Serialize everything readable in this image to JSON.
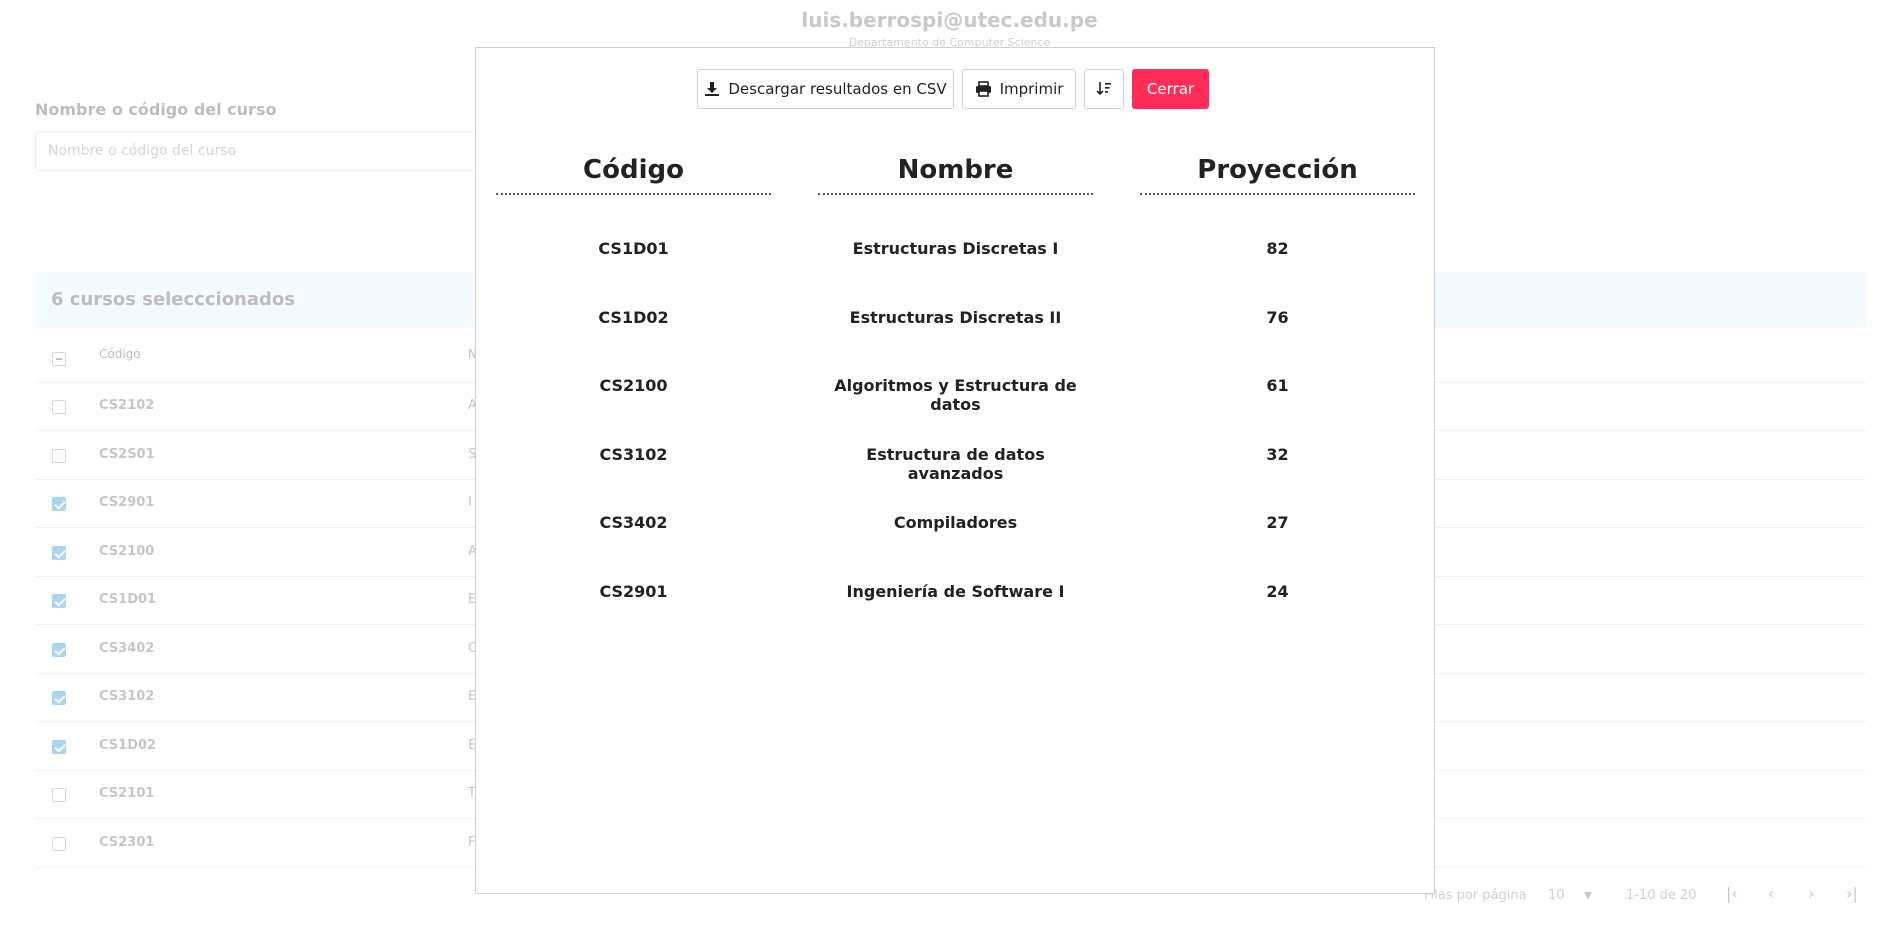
{
  "header": {
    "email": "luis.berrospi@utec.edu.pe",
    "department": "Departamento de Computer Science"
  },
  "search": {
    "label": "Nombre o código del curso",
    "placeholder": "Nombre o código del curso"
  },
  "selection": {
    "summary": "6 cursos selecccionados"
  },
  "table": {
    "header_code": "Código",
    "header_name_initial": "N",
    "rows": [
      {
        "code": "CS2102",
        "initial": "A",
        "checked": false
      },
      {
        "code": "CS2S01",
        "initial": "S",
        "checked": false
      },
      {
        "code": "CS2901",
        "initial": "I",
        "checked": true
      },
      {
        "code": "CS2100",
        "initial": "A",
        "checked": true
      },
      {
        "code": "CS1D01",
        "initial": "E",
        "checked": true
      },
      {
        "code": "CS3402",
        "initial": "C",
        "checked": true
      },
      {
        "code": "CS3102",
        "initial": "E",
        "checked": true
      },
      {
        "code": "CS1D02",
        "initial": "E",
        "checked": true
      },
      {
        "code": "CS2101",
        "initial": "T",
        "checked": false
      },
      {
        "code": "CS2301",
        "initial": "F",
        "checked": false
      }
    ]
  },
  "pagination": {
    "rows_per_page_label": "Filas por página",
    "rows_per_page_value": "10",
    "range": "1-10 de 20"
  },
  "modal": {
    "toolbar": {
      "csv_label": "Descargar resultados en CSV",
      "print_label": "Imprimir",
      "close_label": "Cerrar",
      "close_color": "#ff2e59"
    },
    "columns": {
      "code": "Código",
      "name": "Nombre",
      "projection": "Proyección"
    },
    "results": [
      {
        "code": "CS1D01",
        "name": "Estructuras Discretas I",
        "projection": "82"
      },
      {
        "code": "CS1D02",
        "name": "Estructuras Discretas II",
        "projection": "76"
      },
      {
        "code": "CS2100",
        "name": "Algoritmos y Estructura de datos",
        "projection": "61"
      },
      {
        "code": "CS3102",
        "name": "Estructura de datos avanzados",
        "projection": "32"
      },
      {
        "code": "CS3402",
        "name": "Compiladores",
        "projection": "27"
      },
      {
        "code": "CS2901",
        "name": "Ingeniería de Software I",
        "projection": "24"
      }
    ]
  }
}
